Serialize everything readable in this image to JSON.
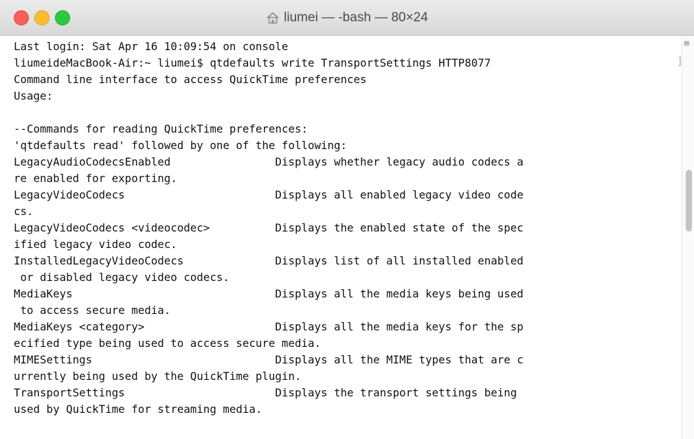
{
  "window": {
    "title": "liumei — -bash — 80×24"
  },
  "terminal": {
    "lines": [
      "Last login: Sat Apr 16 10:09:54 on console",
      "liumeideMacBook-Air:~ liumei$ qtdefaults write TransportSettings HTTP8077",
      "Command line interface to access QuickTime preferences",
      "Usage:",
      "",
      "--Commands for reading QuickTime preferences:",
      "'qtdefaults read' followed by one of the following:",
      "LegacyAudioCodecsEnabled                Displays whether legacy audio codecs a",
      "re enabled for exporting.",
      "LegacyVideoCodecs                       Displays all enabled legacy video code",
      "cs.",
      "LegacyVideoCodecs <videocodec>          Displays the enabled state of the spec",
      "ified legacy video codec.",
      "InstalledLegacyVideoCodecs              Displays list of all installed enabled",
      " or disabled legacy video codecs.",
      "MediaKeys                               Displays all the media keys being used",
      " to access secure media.",
      "MediaKeys <category>                    Displays all the media keys for the sp",
      "ecified type being used to access secure media.",
      "MIMESettings                            Displays all the MIME types that are c",
      "urrently being used by the QuickTime plugin.",
      "TransportSettings                       Displays the transport settings being",
      "used by QuickTime for streaming media."
    ]
  }
}
